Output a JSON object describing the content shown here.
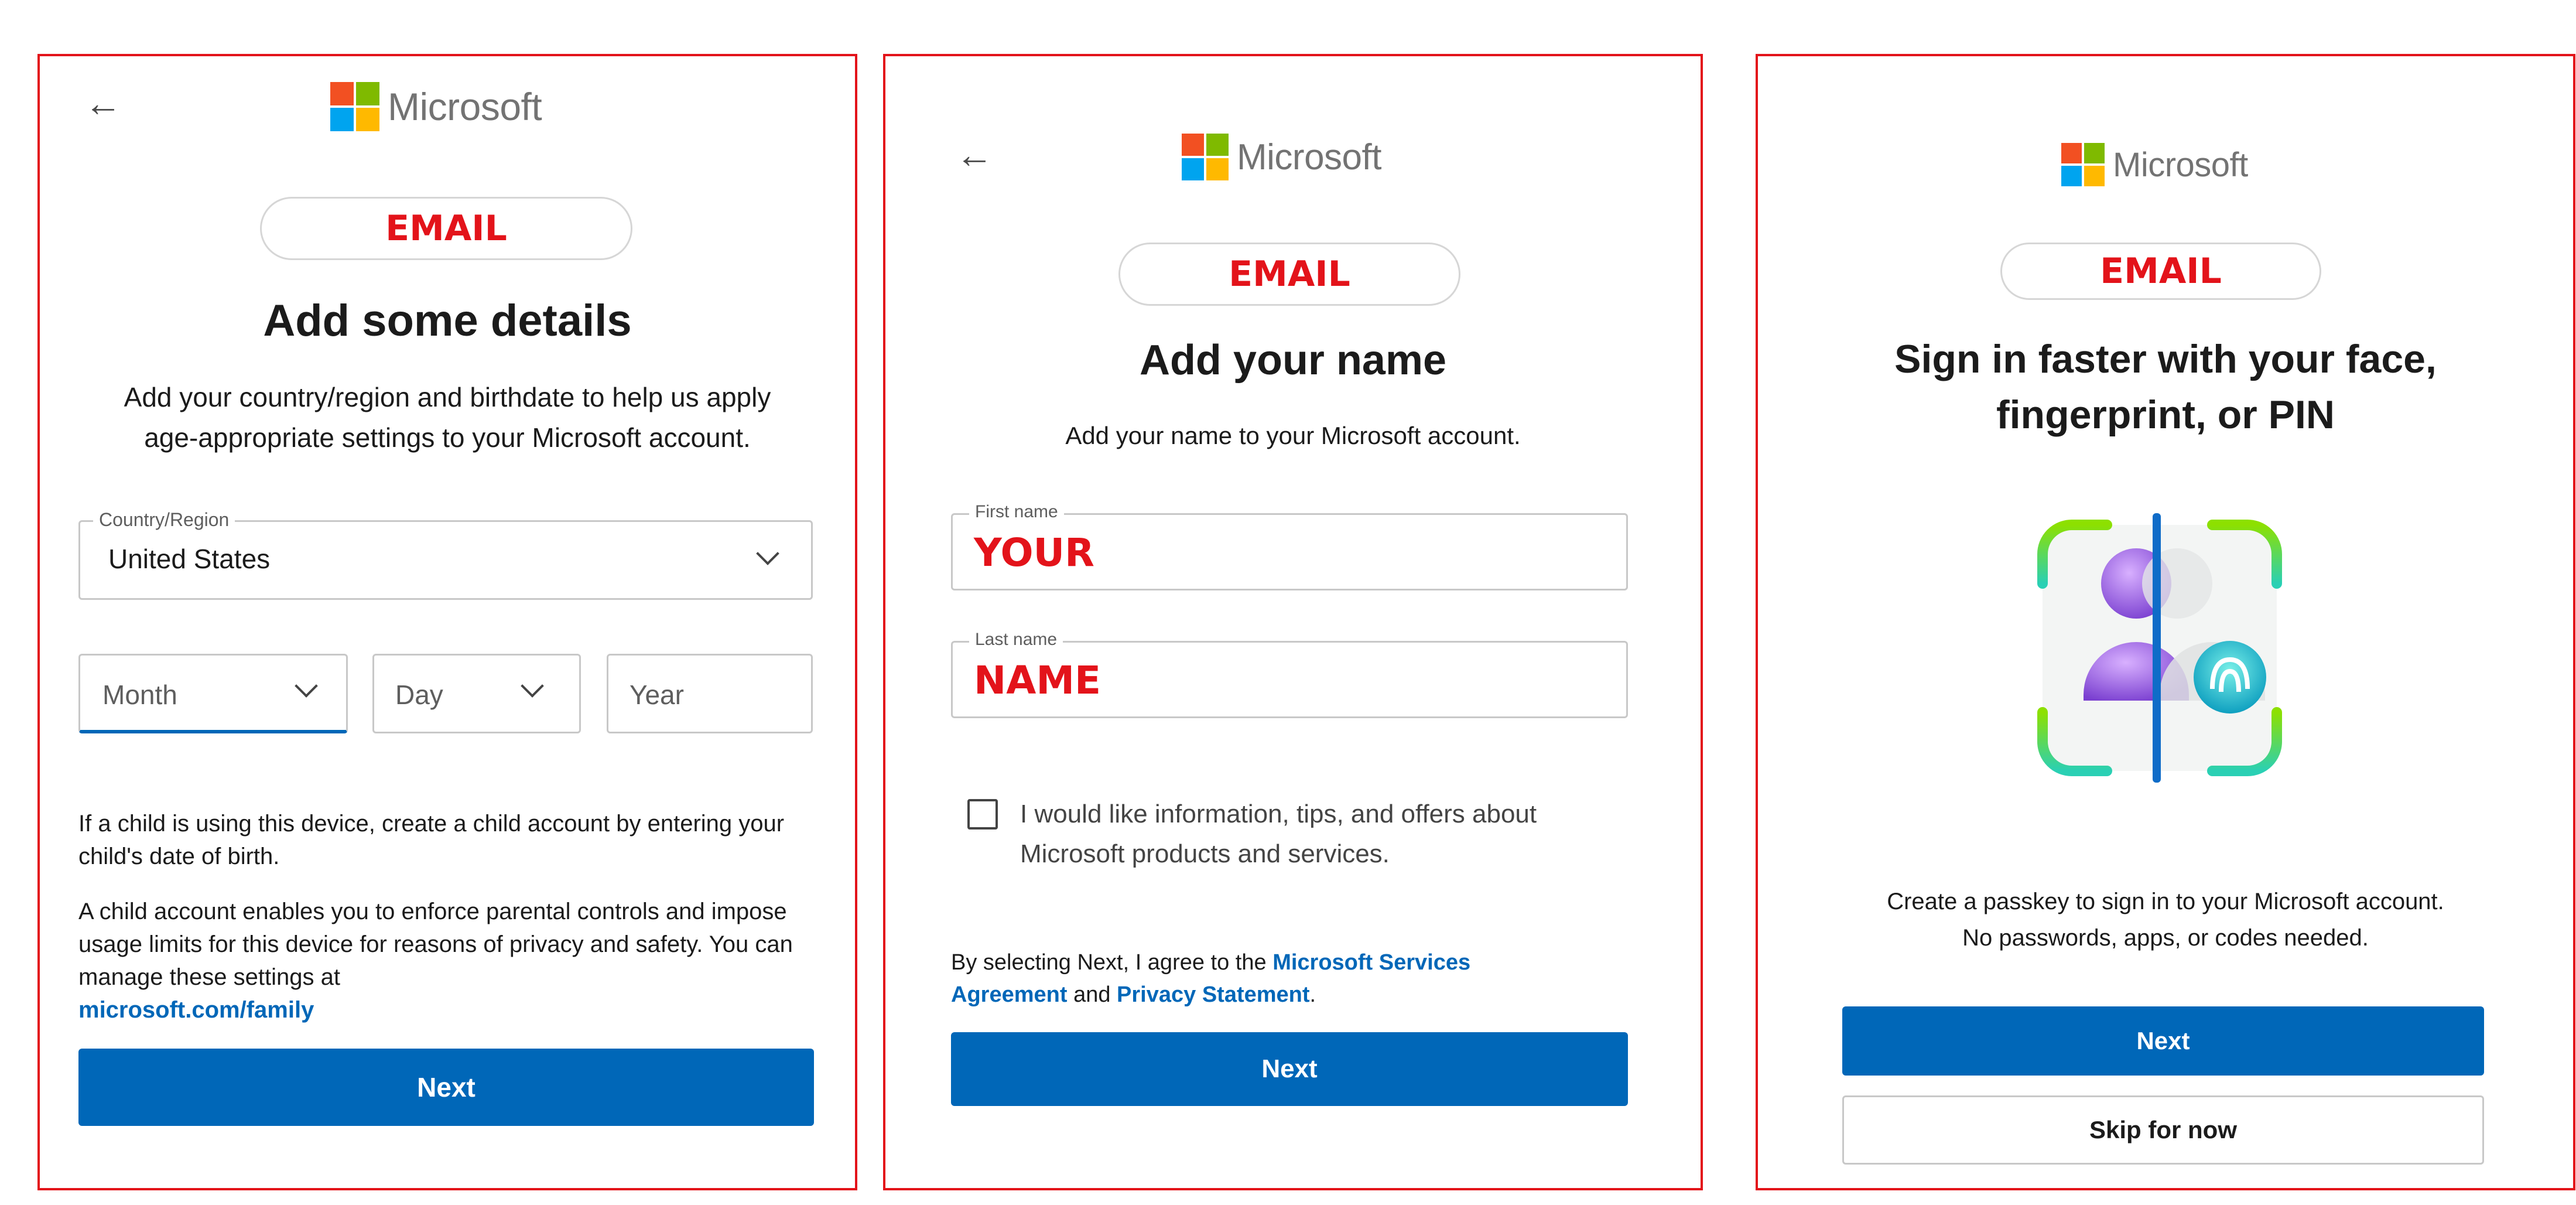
{
  "brand": {
    "name": "Microsoft",
    "colors": {
      "red": "#f25022",
      "green": "#7fba00",
      "blue": "#00a4ef",
      "yellow": "#ffb900",
      "accent": "#0067b8",
      "annotation": "#e3131a"
    }
  },
  "panel1": {
    "back_icon": "arrow-left-icon",
    "email_badge": "EMAIL",
    "title": "Add some details",
    "subtitle_line1": "Add your country/region and birthdate to help us apply",
    "subtitle_line2": "age-appropriate settings to your Microsoft account.",
    "country_label": "Country/Region",
    "country_value": "United States",
    "month_placeholder": "Month",
    "day_placeholder": "Day",
    "year_placeholder": "Year",
    "child_note": "If a child is using this device, create a child account by entering your child's date of birth.",
    "child_account_text": "A child account enables you to enforce parental controls and impose usage limits for this device for reasons of privacy and safety. You can manage these settings at",
    "family_link": "microsoft.com/family",
    "next_label": "Next"
  },
  "panel2": {
    "back_icon": "arrow-left-icon",
    "email_badge": "EMAIL",
    "title": "Add your name",
    "subtitle": "Add your name to your Microsoft account.",
    "first_name_label": "First name",
    "first_name_value": "YOUR",
    "last_name_label": "Last name",
    "last_name_value": "NAME",
    "checkbox_checked": false,
    "checkbox_label_line1": "I would like information, tips, and offers about",
    "checkbox_label_line2": "Microsoft products and services.",
    "agree_prefix": "By selecting Next, I agree to the",
    "services_link": "Microsoft Services Agreement",
    "and_text": "and",
    "privacy_link": "Privacy Statement",
    "period": ".",
    "next_label": "Next"
  },
  "panel3": {
    "email_badge": "EMAIL",
    "title_line1": "Sign in faster with your face,",
    "title_line2": "fingerprint, or PIN",
    "illustration_icon": "passkey-face-fingerprint-icon",
    "desc_line1": "Create a passkey to sign in to your Microsoft account.",
    "desc_line2": "No passwords, apps, or codes needed.",
    "next_label": "Next",
    "skip_label": "Skip for now"
  }
}
